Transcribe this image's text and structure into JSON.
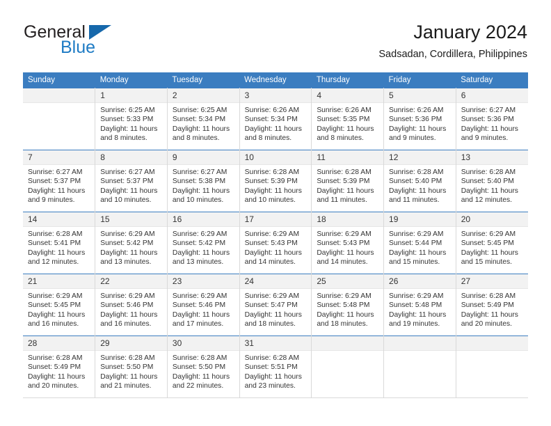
{
  "brand": {
    "name_dark": "General",
    "name_light": "Blue",
    "accent_color": "#1668ab"
  },
  "header": {
    "title": "January 2024",
    "subtitle": "Sadsadan, Cordillera, Philippines"
  },
  "calendar": {
    "header_bg": "#3b7dc0",
    "daynum_bg": "#f2f2f2",
    "weekdays": [
      "Sunday",
      "Monday",
      "Tuesday",
      "Wednesday",
      "Thursday",
      "Friday",
      "Saturday"
    ],
    "labels": {
      "sunrise": "Sunrise:",
      "sunset": "Sunset:",
      "daylight": "Daylight:"
    },
    "weeks": [
      [
        {
          "day": "",
          "blank": true,
          "sunrise": "",
          "sunset": "",
          "daylight_line1": "",
          "daylight_line2": ""
        },
        {
          "day": "1",
          "sunrise": "Sunrise: 6:25 AM",
          "sunset": "Sunset: 5:33 PM",
          "daylight_line1": "Daylight: 11 hours",
          "daylight_line2": "and 8 minutes."
        },
        {
          "day": "2",
          "sunrise": "Sunrise: 6:25 AM",
          "sunset": "Sunset: 5:34 PM",
          "daylight_line1": "Daylight: 11 hours",
          "daylight_line2": "and 8 minutes."
        },
        {
          "day": "3",
          "sunrise": "Sunrise: 6:26 AM",
          "sunset": "Sunset: 5:34 PM",
          "daylight_line1": "Daylight: 11 hours",
          "daylight_line2": "and 8 minutes."
        },
        {
          "day": "4",
          "sunrise": "Sunrise: 6:26 AM",
          "sunset": "Sunset: 5:35 PM",
          "daylight_line1": "Daylight: 11 hours",
          "daylight_line2": "and 8 minutes."
        },
        {
          "day": "5",
          "sunrise": "Sunrise: 6:26 AM",
          "sunset": "Sunset: 5:36 PM",
          "daylight_line1": "Daylight: 11 hours",
          "daylight_line2": "and 9 minutes."
        },
        {
          "day": "6",
          "sunrise": "Sunrise: 6:27 AM",
          "sunset": "Sunset: 5:36 PM",
          "daylight_line1": "Daylight: 11 hours",
          "daylight_line2": "and 9 minutes."
        }
      ],
      [
        {
          "day": "7",
          "sunrise": "Sunrise: 6:27 AM",
          "sunset": "Sunset: 5:37 PM",
          "daylight_line1": "Daylight: 11 hours",
          "daylight_line2": "and 9 minutes."
        },
        {
          "day": "8",
          "sunrise": "Sunrise: 6:27 AM",
          "sunset": "Sunset: 5:37 PM",
          "daylight_line1": "Daylight: 11 hours",
          "daylight_line2": "and 10 minutes."
        },
        {
          "day": "9",
          "sunrise": "Sunrise: 6:27 AM",
          "sunset": "Sunset: 5:38 PM",
          "daylight_line1": "Daylight: 11 hours",
          "daylight_line2": "and 10 minutes."
        },
        {
          "day": "10",
          "sunrise": "Sunrise: 6:28 AM",
          "sunset": "Sunset: 5:39 PM",
          "daylight_line1": "Daylight: 11 hours",
          "daylight_line2": "and 10 minutes."
        },
        {
          "day": "11",
          "sunrise": "Sunrise: 6:28 AM",
          "sunset": "Sunset: 5:39 PM",
          "daylight_line1": "Daylight: 11 hours",
          "daylight_line2": "and 11 minutes."
        },
        {
          "day": "12",
          "sunrise": "Sunrise: 6:28 AM",
          "sunset": "Sunset: 5:40 PM",
          "daylight_line1": "Daylight: 11 hours",
          "daylight_line2": "and 11 minutes."
        },
        {
          "day": "13",
          "sunrise": "Sunrise: 6:28 AM",
          "sunset": "Sunset: 5:40 PM",
          "daylight_line1": "Daylight: 11 hours",
          "daylight_line2": "and 12 minutes."
        }
      ],
      [
        {
          "day": "14",
          "sunrise": "Sunrise: 6:28 AM",
          "sunset": "Sunset: 5:41 PM",
          "daylight_line1": "Daylight: 11 hours",
          "daylight_line2": "and 12 minutes."
        },
        {
          "day": "15",
          "sunrise": "Sunrise: 6:29 AM",
          "sunset": "Sunset: 5:42 PM",
          "daylight_line1": "Daylight: 11 hours",
          "daylight_line2": "and 13 minutes."
        },
        {
          "day": "16",
          "sunrise": "Sunrise: 6:29 AM",
          "sunset": "Sunset: 5:42 PM",
          "daylight_line1": "Daylight: 11 hours",
          "daylight_line2": "and 13 minutes."
        },
        {
          "day": "17",
          "sunrise": "Sunrise: 6:29 AM",
          "sunset": "Sunset: 5:43 PM",
          "daylight_line1": "Daylight: 11 hours",
          "daylight_line2": "and 14 minutes."
        },
        {
          "day": "18",
          "sunrise": "Sunrise: 6:29 AM",
          "sunset": "Sunset: 5:43 PM",
          "daylight_line1": "Daylight: 11 hours",
          "daylight_line2": "and 14 minutes."
        },
        {
          "day": "19",
          "sunrise": "Sunrise: 6:29 AM",
          "sunset": "Sunset: 5:44 PM",
          "daylight_line1": "Daylight: 11 hours",
          "daylight_line2": "and 15 minutes."
        },
        {
          "day": "20",
          "sunrise": "Sunrise: 6:29 AM",
          "sunset": "Sunset: 5:45 PM",
          "daylight_line1": "Daylight: 11 hours",
          "daylight_line2": "and 15 minutes."
        }
      ],
      [
        {
          "day": "21",
          "sunrise": "Sunrise: 6:29 AM",
          "sunset": "Sunset: 5:45 PM",
          "daylight_line1": "Daylight: 11 hours",
          "daylight_line2": "and 16 minutes."
        },
        {
          "day": "22",
          "sunrise": "Sunrise: 6:29 AM",
          "sunset": "Sunset: 5:46 PM",
          "daylight_line1": "Daylight: 11 hours",
          "daylight_line2": "and 16 minutes."
        },
        {
          "day": "23",
          "sunrise": "Sunrise: 6:29 AM",
          "sunset": "Sunset: 5:46 PM",
          "daylight_line1": "Daylight: 11 hours",
          "daylight_line2": "and 17 minutes."
        },
        {
          "day": "24",
          "sunrise": "Sunrise: 6:29 AM",
          "sunset": "Sunset: 5:47 PM",
          "daylight_line1": "Daylight: 11 hours",
          "daylight_line2": "and 18 minutes."
        },
        {
          "day": "25",
          "sunrise": "Sunrise: 6:29 AM",
          "sunset": "Sunset: 5:48 PM",
          "daylight_line1": "Daylight: 11 hours",
          "daylight_line2": "and 18 minutes."
        },
        {
          "day": "26",
          "sunrise": "Sunrise: 6:29 AM",
          "sunset": "Sunset: 5:48 PM",
          "daylight_line1": "Daylight: 11 hours",
          "daylight_line2": "and 19 minutes."
        },
        {
          "day": "27",
          "sunrise": "Sunrise: 6:28 AM",
          "sunset": "Sunset: 5:49 PM",
          "daylight_line1": "Daylight: 11 hours",
          "daylight_line2": "and 20 minutes."
        }
      ],
      [
        {
          "day": "28",
          "sunrise": "Sunrise: 6:28 AM",
          "sunset": "Sunset: 5:49 PM",
          "daylight_line1": "Daylight: 11 hours",
          "daylight_line2": "and 20 minutes."
        },
        {
          "day": "29",
          "sunrise": "Sunrise: 6:28 AM",
          "sunset": "Sunset: 5:50 PM",
          "daylight_line1": "Daylight: 11 hours",
          "daylight_line2": "and 21 minutes."
        },
        {
          "day": "30",
          "sunrise": "Sunrise: 6:28 AM",
          "sunset": "Sunset: 5:50 PM",
          "daylight_line1": "Daylight: 11 hours",
          "daylight_line2": "and 22 minutes."
        },
        {
          "day": "31",
          "sunrise": "Sunrise: 6:28 AM",
          "sunset": "Sunset: 5:51 PM",
          "daylight_line1": "Daylight: 11 hours",
          "daylight_line2": "and 23 minutes."
        },
        {
          "day": "",
          "blank": true,
          "sunrise": "",
          "sunset": "",
          "daylight_line1": "",
          "daylight_line2": ""
        },
        {
          "day": "",
          "blank": true,
          "sunrise": "",
          "sunset": "",
          "daylight_line1": "",
          "daylight_line2": ""
        },
        {
          "day": "",
          "blank": true,
          "sunrise": "",
          "sunset": "",
          "daylight_line1": "",
          "daylight_line2": ""
        }
      ]
    ]
  }
}
